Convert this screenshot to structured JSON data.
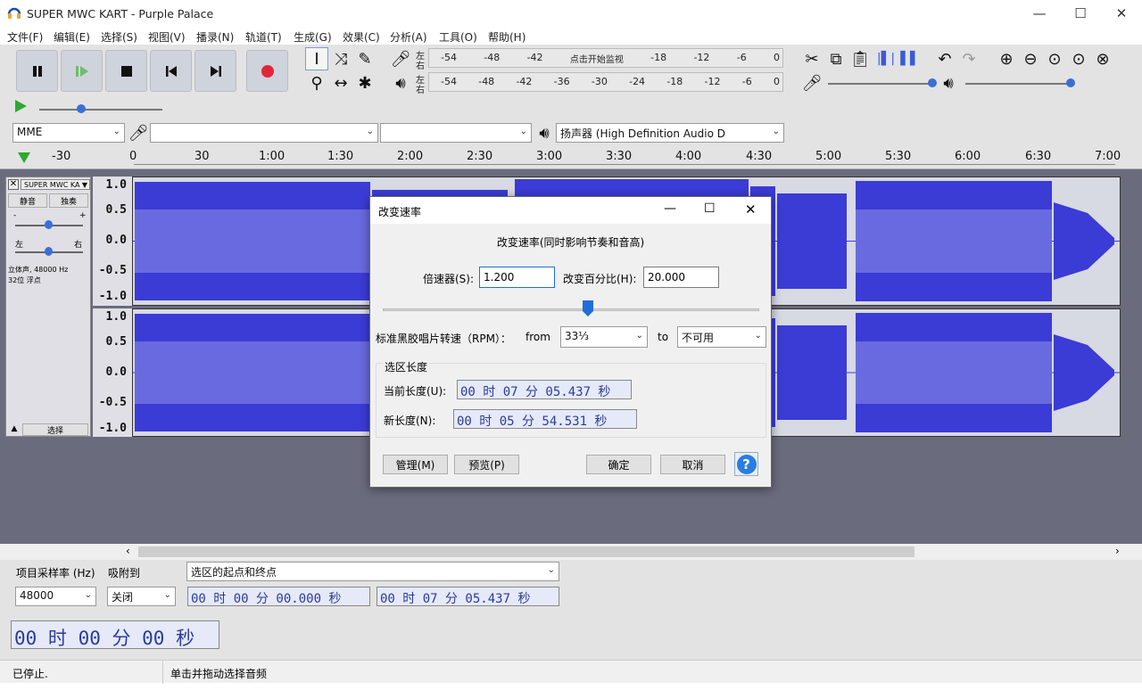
{
  "window": {
    "title": "SUPER MWC KART - Purple Palace"
  },
  "menu": [
    "文件(F)",
    "编辑(E)",
    "选择(S)",
    "视图(V)",
    "播录(N)",
    "轨道(T)",
    "生成(G)",
    "效果(C)",
    "分析(A)",
    "工具(O)",
    "帮助(H)"
  ],
  "meter": {
    "record_label_l": "左",
    "record_label_r": "右",
    "play_label_l": "左",
    "play_label_r": "右",
    "ticks": [
      "-54",
      "-48",
      "-42",
      "-36",
      "-30",
      "-24",
      "-18",
      "-12",
      "-6",
      "0"
    ],
    "monitor_hint": "点击开始监视"
  },
  "device": {
    "host": "MME",
    "input": "",
    "channels": "",
    "output": "扬声器 (High Definition Audio D"
  },
  "timeline": {
    "ticks": [
      "-30",
      "0",
      "30",
      "1:00",
      "1:30",
      "2:00",
      "2:30",
      "3:00",
      "3:30",
      "4:00",
      "4:30",
      "5:00",
      "5:30",
      "6:00",
      "6:30",
      "7:00"
    ]
  },
  "track": {
    "name": "SUPER MWC KA",
    "mute": "静音",
    "solo": "独奏",
    "gain_minus": "-",
    "gain_plus": "+",
    "pan_left": "左",
    "pan_right": "右",
    "info1": "立体声, 48000 Hz",
    "info2": "32位 浮点",
    "select": "选择",
    "axis": [
      "1.0",
      "0.5",
      "0.0",
      "-0.5",
      "-1.0"
    ]
  },
  "dialog": {
    "title": "改变速率",
    "heading": "改变速率(同时影响节奏和音高)",
    "multiplier_label": "倍速器(S):",
    "multiplier_value": "1.200",
    "percent_label": "改变百分比(H):",
    "percent_value": "20.000",
    "slider_fraction": 0.545,
    "rpm_label": "标准黑胶唱片转速（RPM）：",
    "from_label": "from",
    "from_value": "33⅓",
    "to_label": "to",
    "to_value": "不可用",
    "group_label": "选区长度",
    "current_label": "当前长度(U):",
    "current_value": "00 时 07 分 05.437 秒",
    "new_label": "新长度(N):",
    "new_value": "00 时 05 分 54.531 秒",
    "manage": "管理(M)",
    "preview": "预览(P)",
    "ok": "确定",
    "cancel": "取消",
    "help": "?"
  },
  "selection": {
    "rate_label": "项目采样率 (Hz)",
    "snap_label": "吸附到",
    "mode": "选区的起点和终点",
    "rate_value": "48000",
    "snap_value": "关闭",
    "start": "00 时 00 分 00.000 秒",
    "end": "00 时 07 分 05.437 秒",
    "position": "00 时 00 分 00 秒"
  },
  "status": {
    "left": "已停止.",
    "right": "单击并拖动选择音频"
  },
  "colors": {
    "wave": "#3b3bd6",
    "wave_rms": "#6a6ae0",
    "accent": "#1e6fd9"
  }
}
